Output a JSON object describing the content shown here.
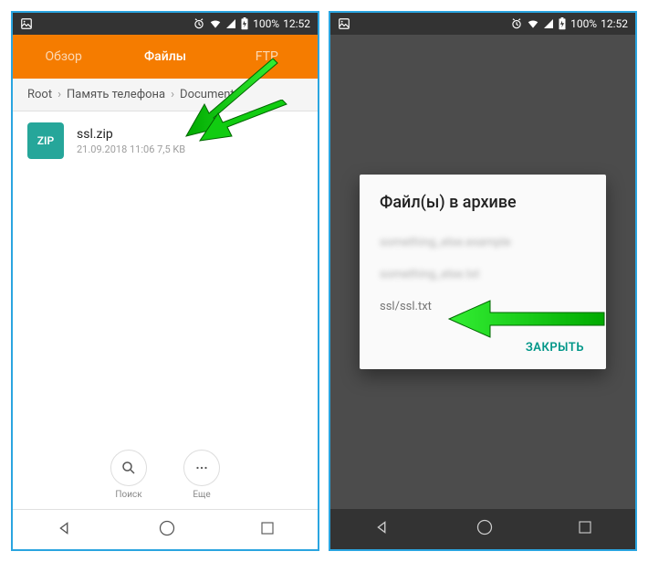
{
  "statusbar": {
    "battery": "100%",
    "time": "12:52"
  },
  "tabs": {
    "overview": "Обзор",
    "files": "Файлы",
    "ftp": "FTP"
  },
  "breadcrumb": {
    "root": "Root",
    "storage": "Память телефона",
    "document": "Document"
  },
  "file": {
    "icon_label": "ZIP",
    "name": "ssl.zip",
    "meta": "21.09.2018 11:06  7,5 KB"
  },
  "actions": {
    "search": "Поиск",
    "more": "Еще"
  },
  "dialog": {
    "title": "Файл(ы) в архиве",
    "item1": "something_else.example",
    "item2": "something_else.txt",
    "item3": "ssl/ssl.txt",
    "close": "ЗАКРЫТЬ"
  }
}
